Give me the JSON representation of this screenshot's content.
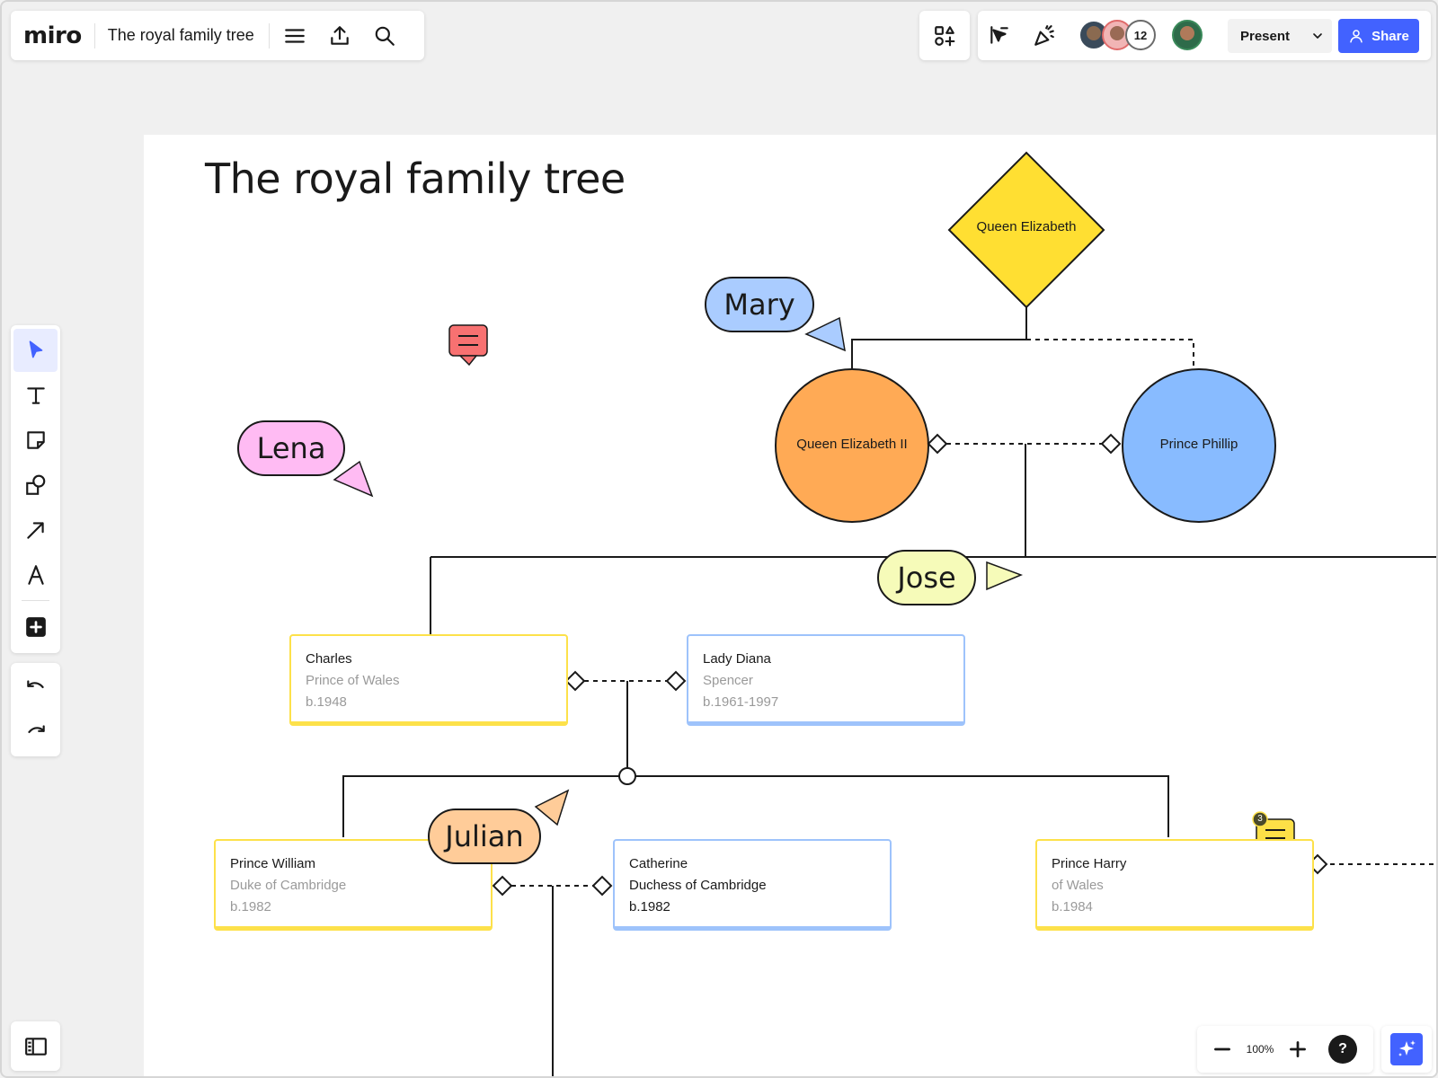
{
  "app": {
    "logo_text": "miro",
    "board_title": "The royal family tree"
  },
  "topbar": {
    "menu_icon": "hamburger-icon",
    "export_icon": "upload-icon",
    "search_icon": "search-icon",
    "apps_icon": "apps-grid-icon",
    "cursor_icon": "cursor-follow-icon",
    "reactions_icon": "party-popper-icon",
    "collaborator_count": "12",
    "present_label": "Present",
    "share_label": "Share"
  },
  "toolbar": {
    "tools": [
      {
        "name": "select",
        "icon": "pointer-icon"
      },
      {
        "name": "text",
        "icon": "text-icon"
      },
      {
        "name": "sticky-note",
        "icon": "sticky-note-icon"
      },
      {
        "name": "shapes",
        "icon": "shapes-icon"
      },
      {
        "name": "arrow",
        "icon": "arrow-icon"
      },
      {
        "name": "pen",
        "icon": "pen-icon"
      },
      {
        "name": "more",
        "icon": "plus-square-icon"
      }
    ],
    "undo_icon": "undo-icon",
    "redo_icon": "redo-icon"
  },
  "zoom": {
    "level": "100%"
  },
  "canvas": {
    "heading": "The royal family tree",
    "shapes": {
      "root": "Queen Elizabeth",
      "queen": "Queen Elizabeth II",
      "prince": "Prince Phillip"
    },
    "cards": [
      {
        "name": "Charles",
        "title": "Prince of Wales",
        "born": "b.1948"
      },
      {
        "name": "Lady Diana",
        "title": "Spencer",
        "born": "b.1961-1997"
      },
      {
        "name": "Prince William",
        "title": "Duke of Cambridge",
        "born": "b.1982"
      },
      {
        "name": "Catherine",
        "title": "Duchess of Cambridge",
        "born": "b.1982"
      },
      {
        "name": "Prince Harry",
        "title": "of Wales",
        "born": "b.1984"
      }
    ],
    "cursors": [
      {
        "name": "Mary",
        "color": "#aaccff"
      },
      {
        "name": "Lena",
        "color": "#ffbbf3"
      },
      {
        "name": "Jose",
        "color": "#f6fbb9"
      },
      {
        "name": "Julian",
        "color": "#ffcc99"
      }
    ],
    "comment_count": "3"
  },
  "colors": {
    "accent": "#4262ff",
    "root_diamond": "#ffdf32",
    "queen_circle": "#ffaa55",
    "prince_circle": "#88bbff",
    "card_yellow": "#fde14a",
    "card_blue": "#9ec3fb",
    "comment_red": "#f87171",
    "comment_yellow": "#fde047"
  }
}
